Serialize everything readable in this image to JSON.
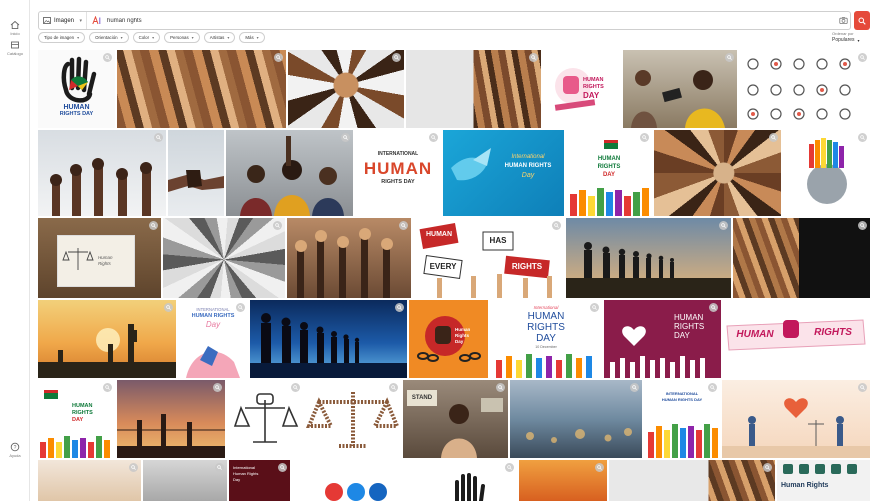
{
  "sidebar": {
    "items": [
      {
        "label": "Inicio",
        "icon": "home-icon"
      },
      {
        "label": "Catálogo",
        "icon": "catalog-icon"
      }
    ],
    "bottom": {
      "label": "Ayuda",
      "icon": "help-icon"
    }
  },
  "search": {
    "type_label": "Imagen",
    "query": "human rights"
  },
  "filters": [
    {
      "label": "Tipo de imagen"
    },
    {
      "label": "Orientación"
    },
    {
      "label": "Color"
    },
    {
      "label": "Personas"
    },
    {
      "label": "Artistas"
    },
    {
      "label": "Más"
    }
  ],
  "sort": {
    "label": "Ordenar por",
    "value": "Populares"
  },
  "tile_texts": {
    "t1": {
      "line1": "HUMAN",
      "line2": "RIGHTS DAY"
    },
    "t6": {
      "line1": "HUMAN",
      "line2": "RIGHTS",
      "line3": "DAY"
    },
    "t13": {
      "line1": "INTERNATIONAL",
      "line2": "HUMAN",
      "line3": "RIGHTS DAY"
    },
    "t14": {
      "line1": "International",
      "line2": "HUMAN RIGHTS",
      "line3": "Day"
    },
    "t15": {
      "line1": "HUMAN",
      "line2": "RIGHTS",
      "line3": "DAY"
    },
    "t18": {
      "line1": "Human",
      "line2": "Rights"
    },
    "t21": {
      "line1": "HUMAN",
      "line2": "HAS",
      "line3": "EVERY",
      "line4": "RIGHTS"
    },
    "t25": {
      "line1": "INTERNATIONAL",
      "line2": "HUMAN RIGHTS",
      "line3": "Day"
    },
    "t27": {
      "line1": "Human",
      "line2": "Rights",
      "line3": "Day"
    },
    "t28": {
      "line1": "International",
      "line2": "HUMAN",
      "line3": "RIGHTS",
      "line4": "DAY",
      "line5": "10 December"
    },
    "t29": {
      "line1": "HUMAN",
      "line2": "RIGHTS",
      "line3": "DAY"
    },
    "t30": {
      "line1": "HUMAN",
      "line2": "RIGHTS"
    },
    "t31": {
      "line1": "HUMAN",
      "line2": "RIGHTS",
      "line3": "DAY"
    },
    "t34": {
      "line1": "STAND"
    },
    "t37": {
      "line1": "INTERNATIONAL",
      "line2": "HUMAN RIGHTS DAY"
    },
    "t41": {
      "line1": "International",
      "line2": "Human Rights",
      "line3": "Day"
    },
    "t48": {
      "line1": "Human Rights"
    }
  }
}
